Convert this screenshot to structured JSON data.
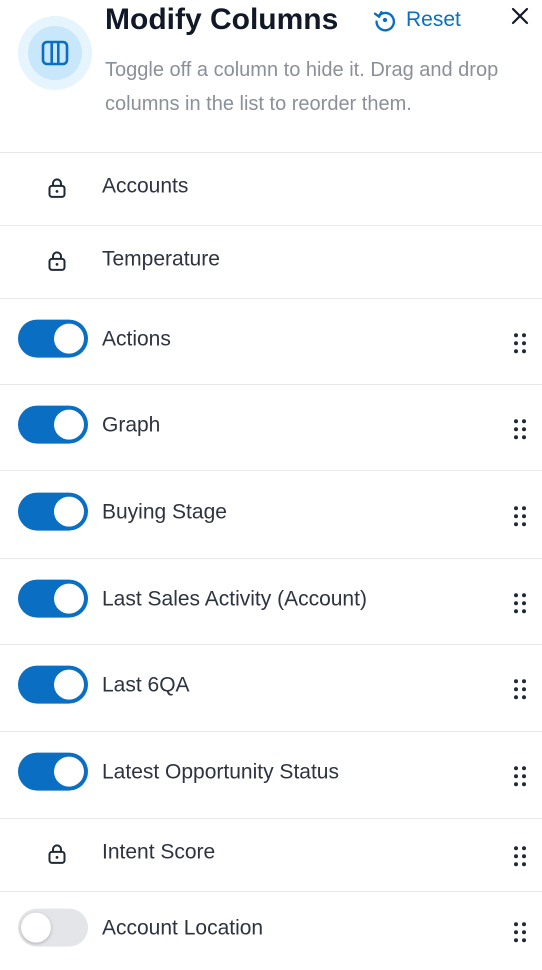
{
  "header": {
    "title": "Modify Columns",
    "reset_label": "Reset",
    "subtitle": "Toggle off a column to hide it. Drag and drop columns in the list to reorder them."
  },
  "colors": {
    "accent": "#0a6fc2",
    "badge_bg": "#e6f4fd",
    "toggle_off": "#e3e5e8"
  },
  "columns": [
    {
      "label": "Accounts",
      "control": "lock",
      "draggable": false
    },
    {
      "label": "Temperature",
      "control": "lock",
      "draggable": false
    },
    {
      "label": "Actions",
      "control": "toggle",
      "enabled": true,
      "draggable": true
    },
    {
      "label": "Graph",
      "control": "toggle",
      "enabled": true,
      "draggable": true
    },
    {
      "label": "Buying Stage",
      "control": "toggle",
      "enabled": true,
      "draggable": true
    },
    {
      "label": "Last Sales Activity (Account)",
      "control": "toggle",
      "enabled": true,
      "draggable": true
    },
    {
      "label": "Last 6QA",
      "control": "toggle",
      "enabled": true,
      "draggable": true
    },
    {
      "label": "Latest Opportunity Status",
      "control": "toggle",
      "enabled": true,
      "draggable": true
    },
    {
      "label": "Intent Score",
      "control": "lock",
      "draggable": true
    },
    {
      "label": "Account Location",
      "control": "toggle",
      "enabled": false,
      "draggable": true
    }
  ]
}
